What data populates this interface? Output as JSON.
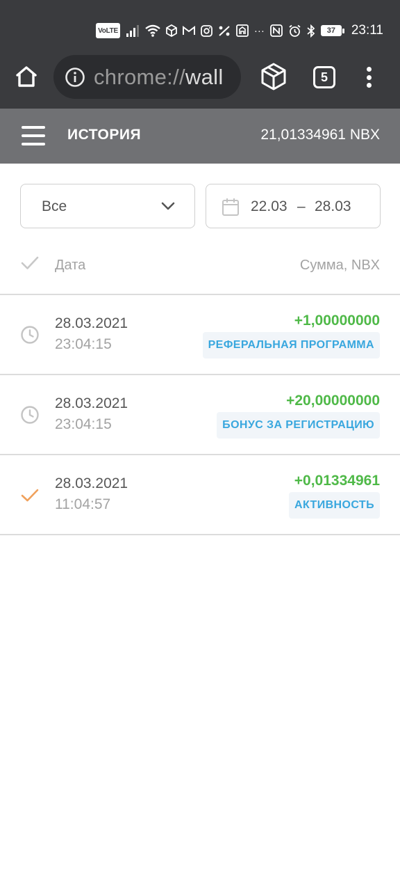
{
  "status_bar": {
    "volte": "VoLTE",
    "battery": "37",
    "time": "23:11"
  },
  "browser": {
    "url_scheme": "chrome://",
    "url_rest": "wall",
    "tab_count": "5"
  },
  "header": {
    "title": "ИСТОРИЯ",
    "balance": "21,01334961 NBX"
  },
  "filters": {
    "type_selected": "Все",
    "date_from": "22.03",
    "date_separator": "–",
    "date_to": "28.03"
  },
  "table": {
    "col_date": "Дата",
    "col_sum": "Сумма, NBX"
  },
  "transactions": [
    {
      "date": "28.03.2021",
      "time": "23:04:15",
      "amount": "+1,00000000",
      "tag": "РЕФЕРАЛЬНАЯ ПРОГРАММА",
      "status": "pending"
    },
    {
      "date": "28.03.2021",
      "time": "23:04:15",
      "amount": "+20,00000000",
      "tag": "БОНУС ЗА РЕГИСТРАЦИЮ",
      "status": "pending"
    },
    {
      "date": "28.03.2021",
      "time": "11:04:57",
      "amount": "+0,01334961",
      "tag": "АКТИВНОСТЬ",
      "status": "completed"
    }
  ],
  "colors": {
    "status_bar_bg": "#3a3b3e",
    "header_bg": "#707174",
    "amount_positive": "#4fb948",
    "tag_text": "#39a7de",
    "completed_check": "#f0a15c",
    "pending_clock": "#c4c4c4"
  },
  "icons": {
    "pending": "clock-icon",
    "completed": "check-icon"
  }
}
